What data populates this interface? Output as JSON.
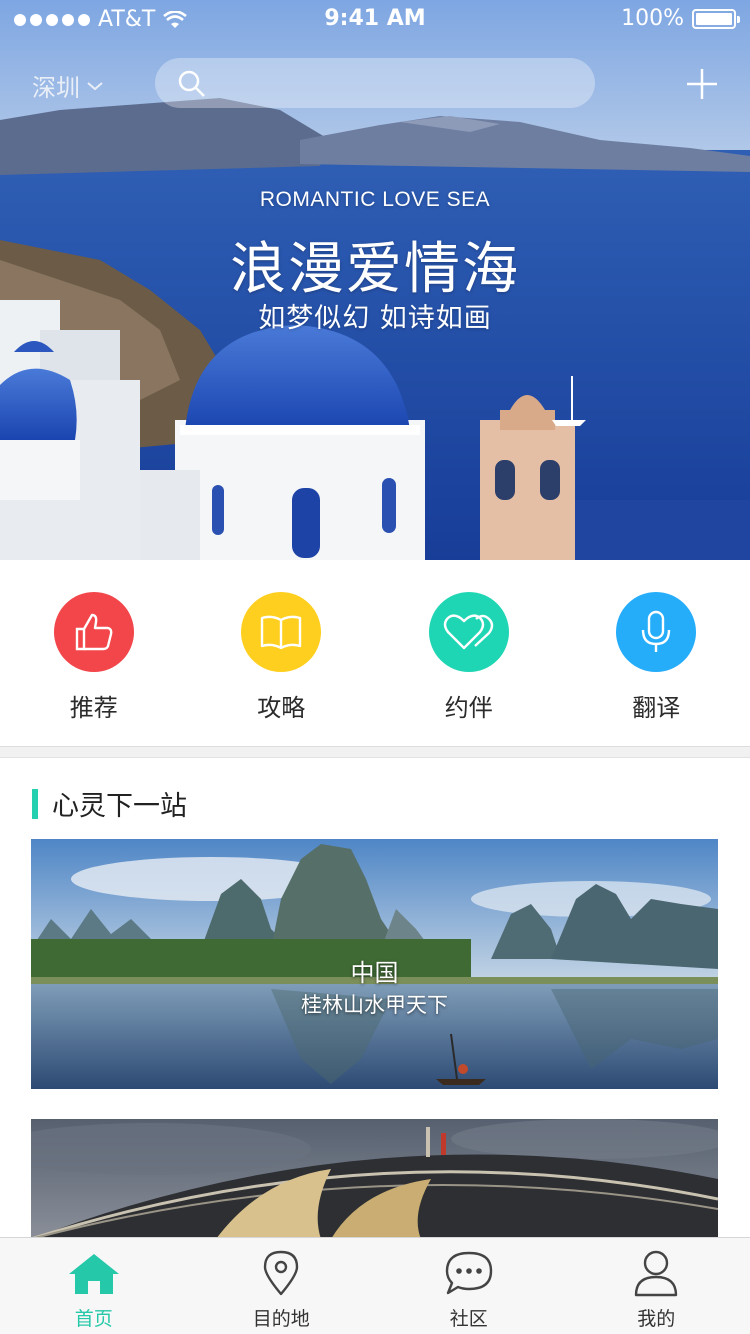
{
  "status_bar": {
    "carrier": "AT&T",
    "time": "9:41 AM",
    "battery": "100%"
  },
  "top_nav": {
    "city": "深圳",
    "search_placeholder": ""
  },
  "hero": {
    "english": "ROMANTIC LOVE SEA",
    "title": "浪漫爱情海",
    "subtitle": "如梦似幻 如诗如画"
  },
  "categories": [
    {
      "label": "推荐",
      "icon": "thumbs-up-icon",
      "color": "#f2464a"
    },
    {
      "label": "攻略",
      "icon": "book-icon",
      "color": "#ffcf1f"
    },
    {
      "label": "约伴",
      "icon": "hearts-icon",
      "color": "#1fd6b4"
    },
    {
      "label": "翻译",
      "icon": "microphone-icon",
      "color": "#26adf9"
    }
  ],
  "section": {
    "title": "心灵下一站"
  },
  "cards": [
    {
      "line1": "中国",
      "line2": "桂林山水甲天下"
    },
    {
      "line1": "",
      "line2": ""
    }
  ],
  "tabbar": {
    "items": [
      {
        "label": "首页",
        "icon": "home-icon",
        "active": true
      },
      {
        "label": "目的地",
        "icon": "location-pin-icon",
        "active": false
      },
      {
        "label": "社区",
        "icon": "chat-bubble-icon",
        "active": false
      },
      {
        "label": "我的",
        "icon": "user-icon",
        "active": false
      }
    ]
  },
  "colors": {
    "accent": "#25c8a8",
    "section_bar": "#25d0b1"
  }
}
